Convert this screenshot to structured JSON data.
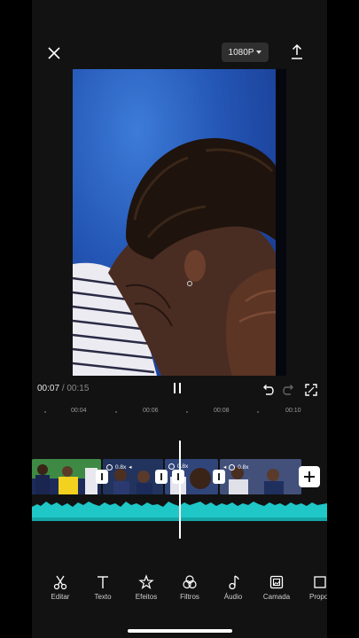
{
  "header": {
    "resolution_label": "1080P"
  },
  "playback": {
    "current_time": "00:07",
    "separator": "/",
    "total_time": "00:15"
  },
  "ruler": {
    "ticks": [
      "00:04",
      "00:06",
      "00:08",
      "00:10"
    ]
  },
  "track": {
    "clips": [
      {
        "speed": ""
      },
      {
        "speed": "0.8x"
      },
      {
        "speed": "0.8x"
      },
      {
        "speed": "0.8x"
      }
    ]
  },
  "toolbar": {
    "items": [
      {
        "label": "Editar",
        "icon": "scissors-icon"
      },
      {
        "label": "Texto",
        "icon": "text-icon"
      },
      {
        "label": "Efeitos",
        "icon": "effects-star-icon"
      },
      {
        "label": "Filtros",
        "icon": "filters-icon"
      },
      {
        "label": "Áudio",
        "icon": "music-note-icon"
      },
      {
        "label": "Camada",
        "icon": "overlay-icon"
      },
      {
        "label": "Propor",
        "icon": "ratio-icon"
      }
    ]
  },
  "colors": {
    "accent": "#1fc7c7",
    "panel": "#121212",
    "preview_bg": "#2456b5"
  }
}
